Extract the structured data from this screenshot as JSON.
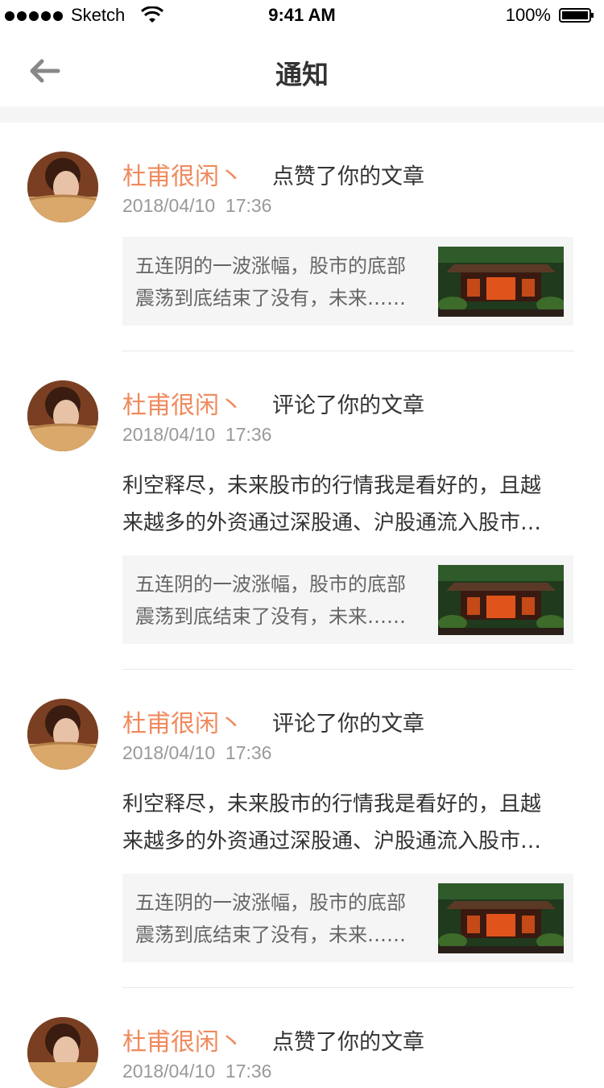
{
  "status_bar": {
    "carrier": "Sketch",
    "time": "9:41 AM",
    "battery": "100%"
  },
  "nav": {
    "title": "通知"
  },
  "notifications": [
    {
      "user": "杜甫很闲丶",
      "action": "点赞了你的文章",
      "date": "2018/04/10",
      "time": "17:36",
      "comment": "",
      "article_line1": "五连阴的一波涨幅，股市的底部",
      "article_line2": "震荡到底结束了没有，未来……"
    },
    {
      "user": "杜甫很闲丶",
      "action": "评论了你的文章",
      "date": "2018/04/10",
      "time": "17:36",
      "comment_line1": "利空释尽，未来股市的行情我是看好的，且越",
      "comment_line2": "来越多的外资通过深股通、沪股通流入股市…",
      "article_line1": "五连阴的一波涨幅，股市的底部",
      "article_line2": "震荡到底结束了没有，未来……"
    },
    {
      "user": "杜甫很闲丶",
      "action": "评论了你的文章",
      "date": "2018/04/10",
      "time": "17:36",
      "comment_line1": "利空释尽，未来股市的行情我是看好的，且越",
      "comment_line2": "来越多的外资通过深股通、沪股通流入股市…",
      "article_line1": "五连阴的一波涨幅，股市的底部",
      "article_line2": "震荡到底结束了没有，未来……"
    },
    {
      "user": "杜甫很闲丶",
      "action": "点赞了你的文章",
      "date": "2018/04/10",
      "time": "17:36"
    }
  ],
  "colors": {
    "username": "#f08a5d",
    "date": "#999999",
    "card_bg": "#f5f5f5"
  }
}
